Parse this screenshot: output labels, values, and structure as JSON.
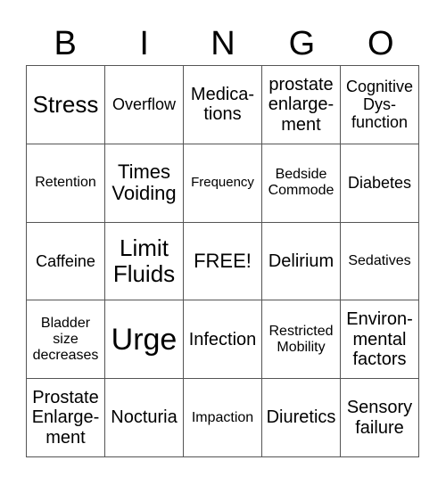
{
  "header": [
    "B",
    "I",
    "N",
    "G",
    "O"
  ],
  "cells": [
    [
      "Stress",
      "Overflow",
      "Medica-\ntions",
      "prostate\nenlarge-\nment",
      "Cognitive\nDys-\nfunction"
    ],
    [
      "Retention",
      "Times\nVoiding",
      "Frequency",
      "Bedside\nCommode",
      "Diabetes"
    ],
    [
      "Caffeine",
      "Limit\nFluids",
      "FREE!",
      "Delirium",
      "Sedatives"
    ],
    [
      "Bladder\nsize\ndecreases",
      "Urge",
      "Infection",
      "Restricted\nMobility",
      "Environ-\nmental\nfactors"
    ],
    [
      "Prostate\nEnlarge-\nment",
      "Nocturia",
      "Impaction",
      "Diuretics",
      "Sensory\nfailure"
    ]
  ]
}
